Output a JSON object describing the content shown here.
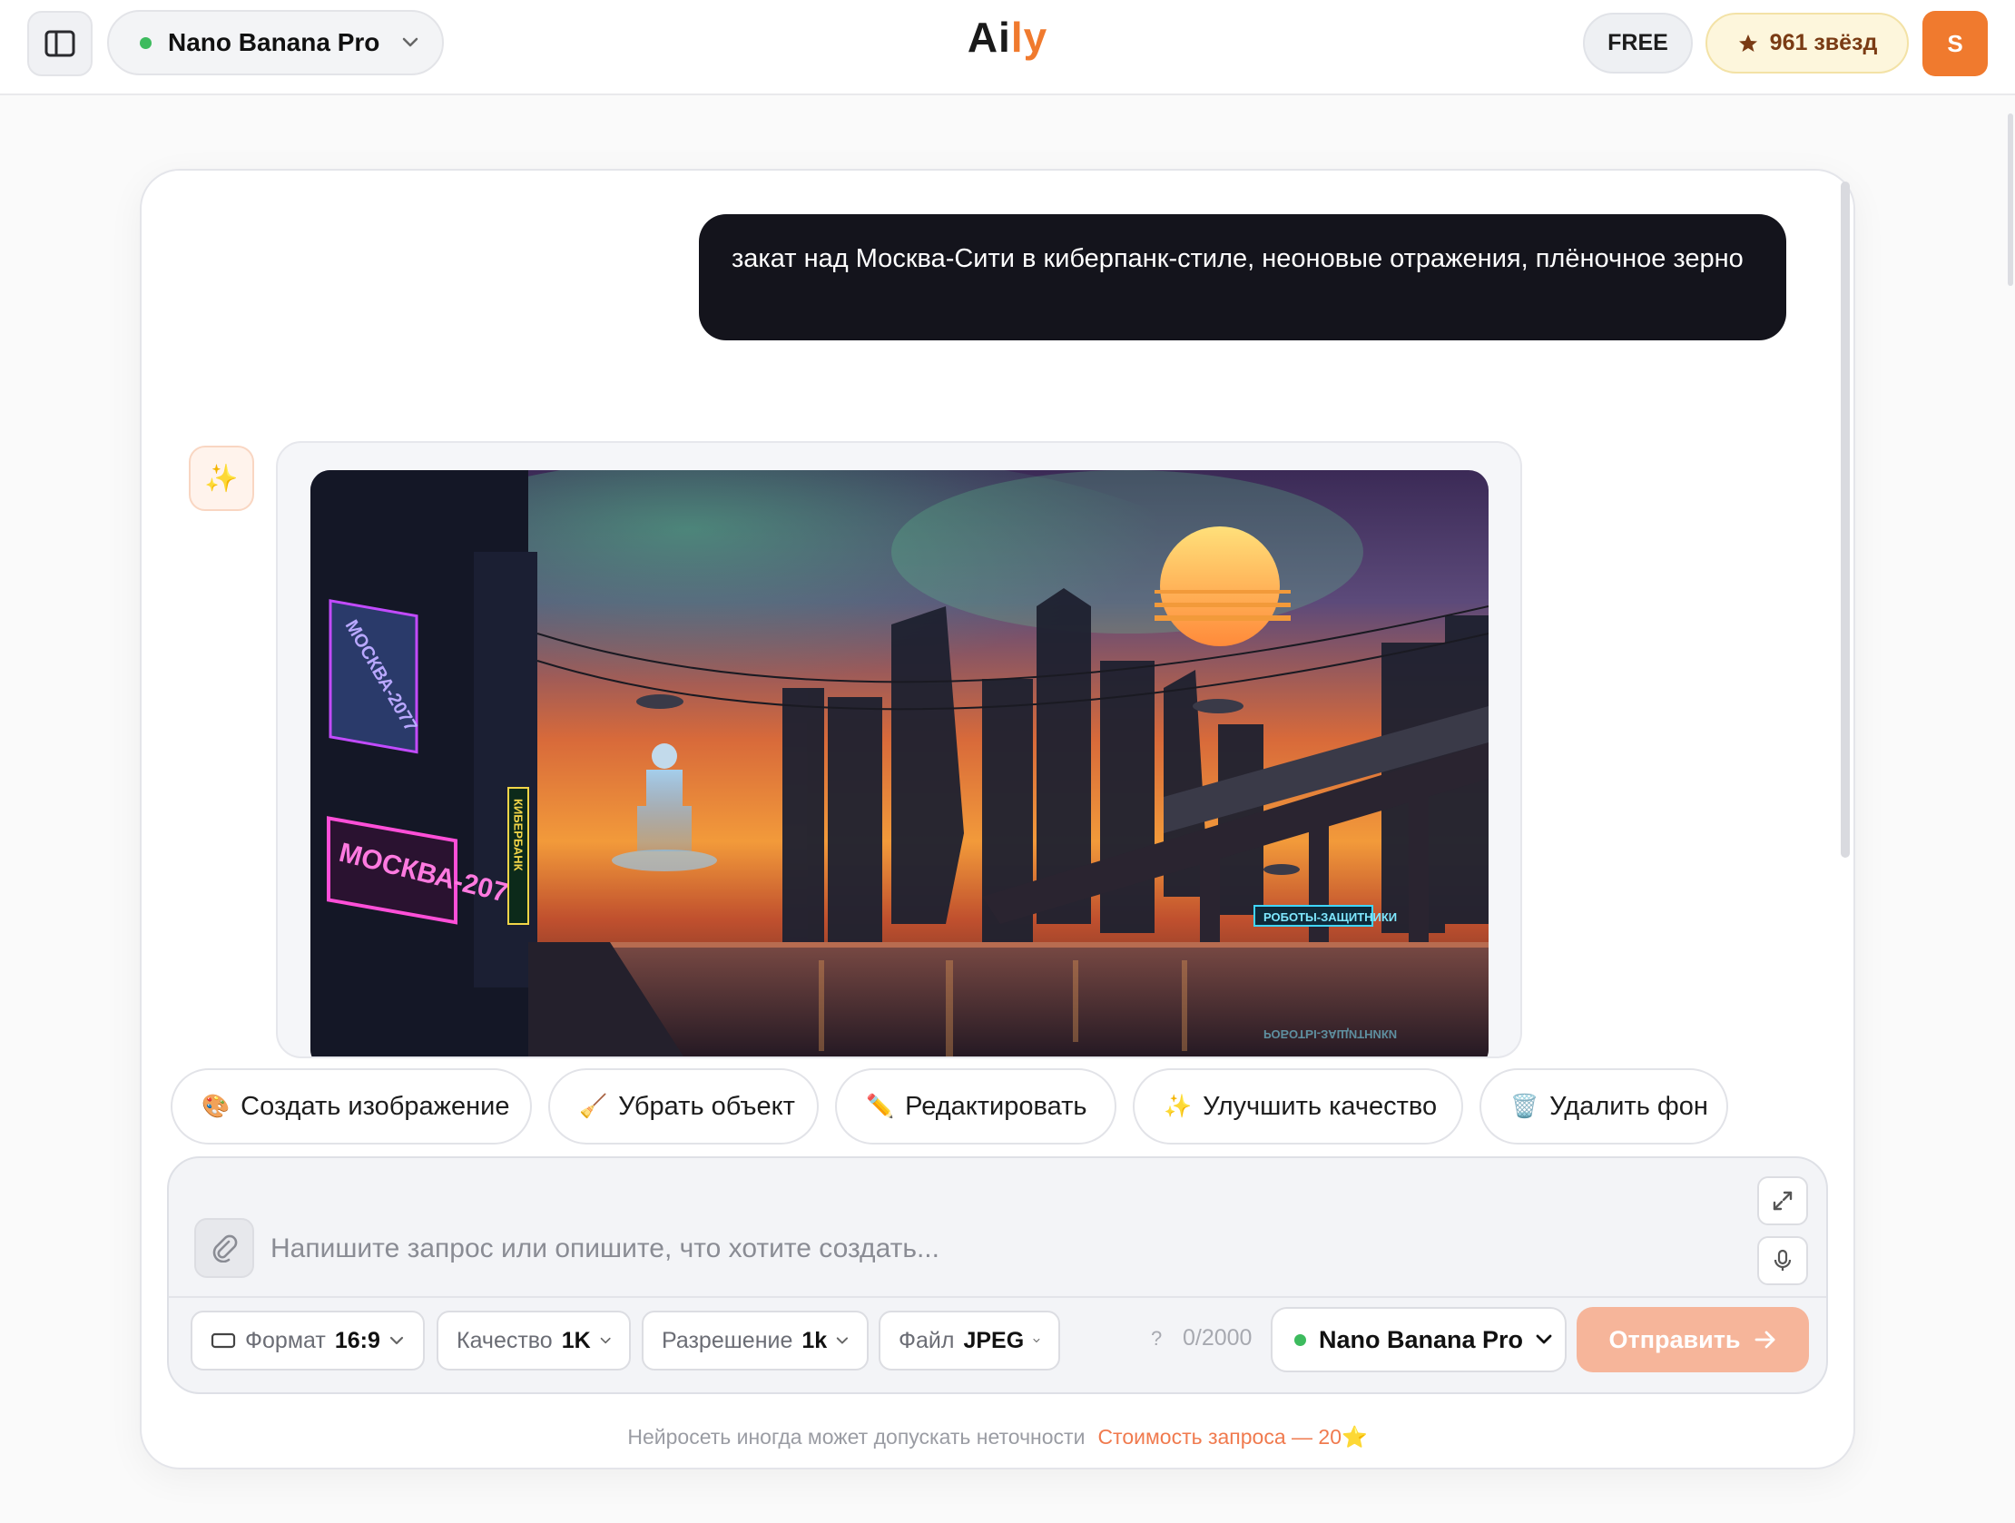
{
  "header": {
    "sidebar_toggle_icon": "sidebar-panel-icon",
    "model_name": "Nano Banana Pro",
    "brand_part1": "Ai",
    "brand_part2": "ly",
    "plan": "FREE",
    "stars_label": "961 звёзд",
    "avatar_initial": "S"
  },
  "chat": {
    "user_message": "закат над Москва-Сити в киберпанк-стиле, неоновые отражения, плёночное зерно",
    "assistant_icon": "✨",
    "image_signs": {
      "billboard_top": "МОСКВА-2077",
      "billboard_bottom": "МОСКВА-2077",
      "vertical_sign": "КИБЕРБАНК",
      "bridge_sign": "РОБОТЫ-ЗАЩИТНИКИ",
      "reflection_sign": "РОБОТЫ-ЗАЩИТНИКИ"
    }
  },
  "actions": [
    {
      "emoji": "🎨",
      "label": "Создать изображение"
    },
    {
      "emoji": "🧹",
      "label": "Убрать объект"
    },
    {
      "emoji": "✏️",
      "label": "Редактировать"
    },
    {
      "emoji": "✨",
      "label": "Улучшить качество"
    },
    {
      "emoji": "🗑️",
      "label": "Удалить фон"
    }
  ],
  "composer": {
    "placeholder": "Напишите запрос или опишите, что хотите создать...",
    "format_label": "Формат",
    "format_value": "16:9",
    "quality_label": "Качество",
    "quality_value": "1K",
    "resolution_label": "Разрешение",
    "resolution_value": "1k",
    "file_label": "Файл",
    "file_value": "JPEG",
    "help_mark": "?",
    "char_count": "0/2000",
    "model_name": "Nano Banana Pro",
    "send_label": "Отправить"
  },
  "footer": {
    "disclaimer": "Нейросеть иногда может допускать неточности",
    "cost": "Стоимость запроса — 20⭐"
  },
  "colors": {
    "accent": "#f07a2e",
    "user_bubble": "#14141c",
    "status_dot": "#3dbb5e",
    "send_disabled": "#f6b59a"
  }
}
